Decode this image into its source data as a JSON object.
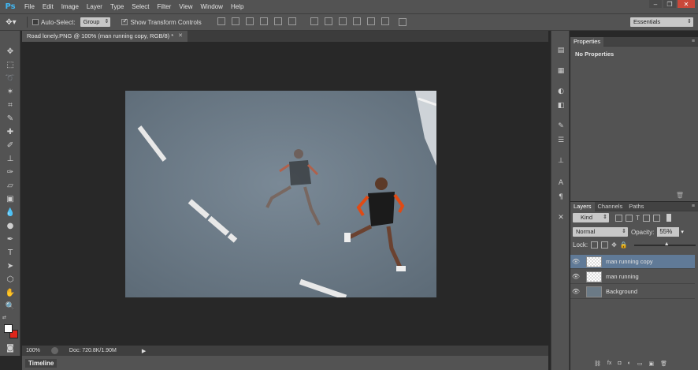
{
  "app": {
    "logo": "Ps"
  },
  "menu": [
    "File",
    "Edit",
    "Image",
    "Layer",
    "Type",
    "Select",
    "Filter",
    "View",
    "Window",
    "Help"
  ],
  "window_controls": {
    "minimize": "–",
    "maximize": "❐",
    "close": "✕"
  },
  "options_bar": {
    "auto_select_label": "Auto-Select:",
    "auto_select_value": "Group",
    "show_transform_label": "Show Transform Controls",
    "workspace": "Essentials"
  },
  "document_tab": {
    "title": "Road lonely.PNG @ 100% (man running copy, RGB/8) *",
    "close": "✕"
  },
  "status_bar": {
    "zoom": "100%",
    "doc": "Doc: 720.8K/1.90M"
  },
  "timeline": {
    "label": "Timeline"
  },
  "properties": {
    "tab": "Properties",
    "content": "No Properties"
  },
  "layers_panel": {
    "tabs": [
      "Layers",
      "Channels",
      "Paths"
    ],
    "kind_label": "Kind",
    "blend_mode": "Normal",
    "opacity_label": "Opacity:",
    "opacity_value": "55%",
    "lock_label": "Lock:",
    "layers": [
      {
        "name": "man running copy",
        "selected": true
      },
      {
        "name": "man running",
        "selected": false
      },
      {
        "name": "Background",
        "selected": false
      }
    ]
  },
  "colors": {
    "accent_logo": "#41b6f1",
    "selected_layer": "#607a97",
    "foreground": "#ffffff",
    "background": "#e0261b"
  }
}
